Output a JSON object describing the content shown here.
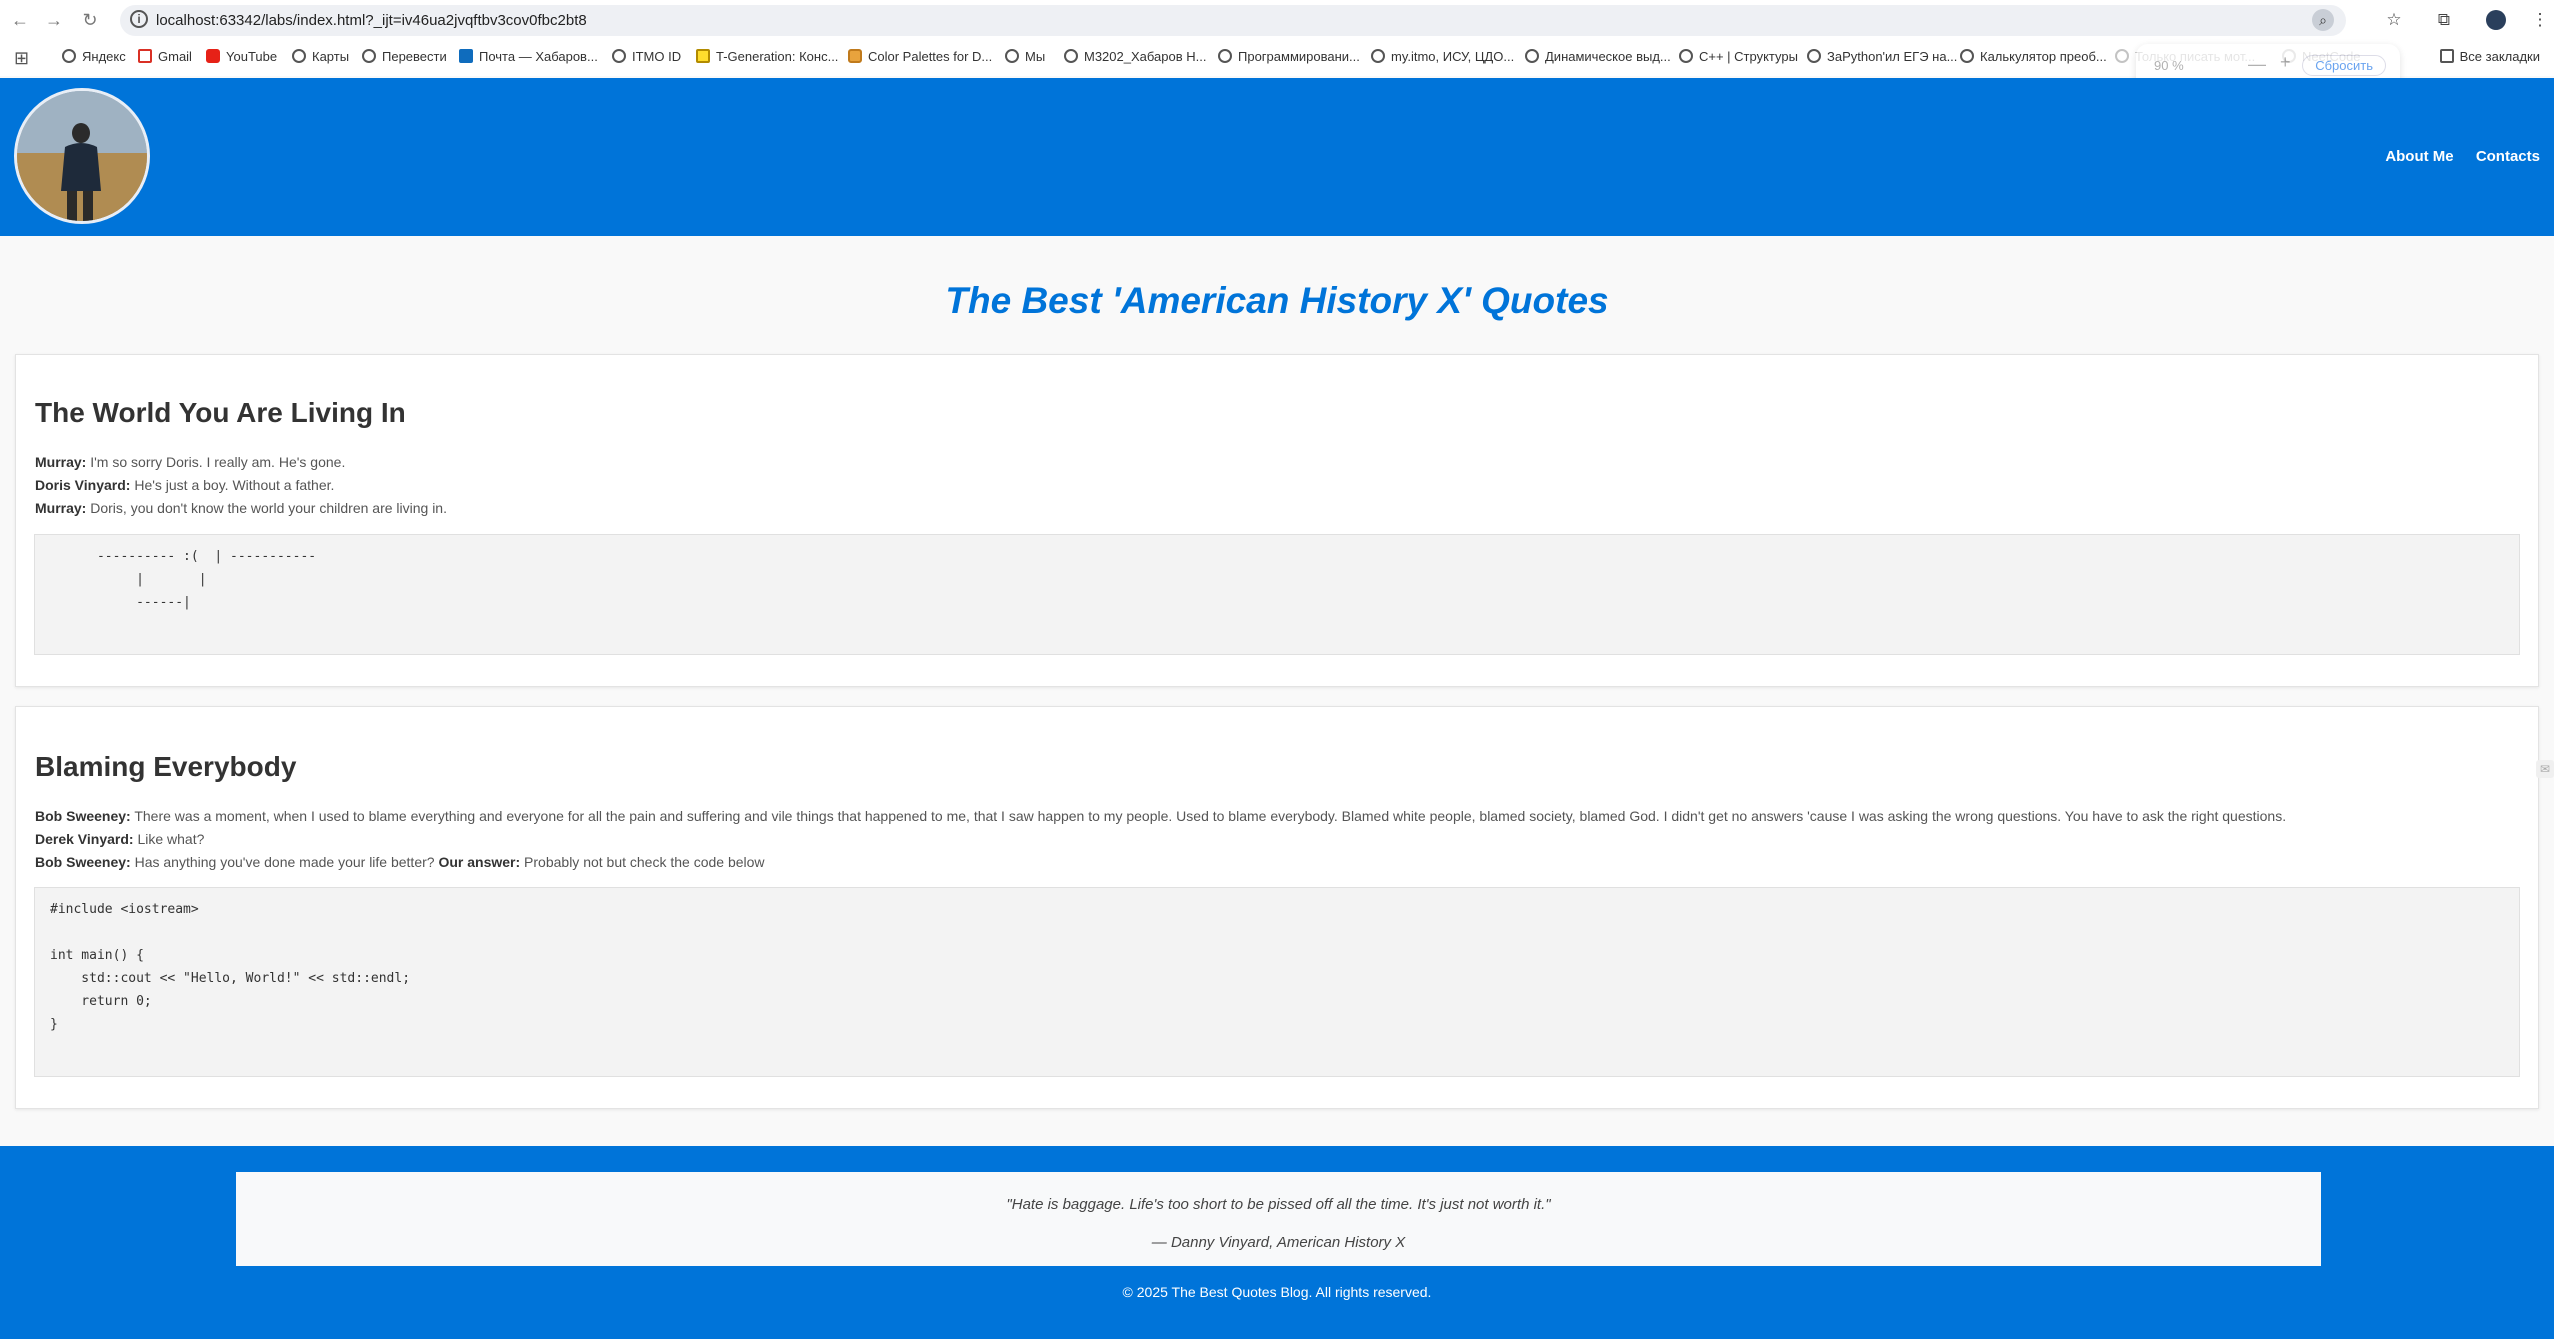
{
  "browser": {
    "url": "localhost:63342/labs/index.html?_ijt=iv46ua2jvqftbv3cov0fbc2bt8",
    "bookmarks": [
      {
        "label": "Яндекс",
        "icon": "globe-icon"
      },
      {
        "label": "Gmail",
        "icon": "gmail-icon"
      },
      {
        "label": "YouTube",
        "icon": "youtube-icon"
      },
      {
        "label": "Карты",
        "icon": "globe-icon"
      },
      {
        "label": "Перевести",
        "icon": "globe-icon"
      },
      {
        "label": "Почта — Хабаров...",
        "icon": "outlook-icon"
      },
      {
        "label": "ITMO ID",
        "icon": "globe-icon"
      },
      {
        "label": "T-Generation: Конс...",
        "icon": "tgen-icon"
      },
      {
        "label": "Color Palettes for D...",
        "icon": "palette-icon"
      },
      {
        "label": "Мы",
        "icon": "globe-icon"
      },
      {
        "label": "M3202_Хабаров Н...",
        "icon": "globe-icon"
      },
      {
        "label": "Программировани...",
        "icon": "globe-icon"
      },
      {
        "label": "my.itmo, ИСУ, ЦДО...",
        "icon": "globe-icon"
      },
      {
        "label": "Динамическое выд...",
        "icon": "globe-icon"
      },
      {
        "label": "C++ | Структуры",
        "icon": "globe-icon"
      },
      {
        "label": "ЗаPython'ил ЕГЭ на...",
        "icon": "globe-icon"
      },
      {
        "label": "Калькулятор преоб...",
        "icon": "globe-icon"
      },
      {
        "label": "Только писать мот...",
        "icon": "globe-icon"
      },
      {
        "label": "NeetCode",
        "icon": "globe-icon"
      }
    ],
    "all_bookmarks_label": "Все закладки",
    "zoom_popup": {
      "zoom": "90 %",
      "reset_label": "Сбросить",
      "minus": "—",
      "plus": "+"
    }
  },
  "site": {
    "nav": {
      "about": "About Me",
      "contacts": "Contacts"
    },
    "title": "The Best 'American History X' Quotes",
    "sections": [
      {
        "heading": "The World You Are Living In",
        "lines": [
          {
            "speaker": "Murray:",
            "text": " I'm so sorry Doris. I really am. He's gone."
          },
          {
            "speaker": "Doris Vinyard:",
            "text": " He's just a boy. Without a father."
          },
          {
            "speaker": "Murray:",
            "text": " Doris, you don't know the world your children are living in."
          }
        ],
        "code": "      ---------- :(  | -----------\n           |       |\n           ------|"
      },
      {
        "heading": "Blaming Everybody",
        "lines": [
          {
            "speaker": "Bob Sweeney:",
            "text": " There was a moment, when I used to blame everything and everyone for all the pain and suffering and vile things that happened to me, that I saw happen to my people. Used to blame everybody. Blamed white people, blamed society, blamed God. I didn't get no answers 'cause I was asking the wrong questions. You have to ask the right questions."
          },
          {
            "speaker": "Derek Vinyard:",
            "text": " Like what?"
          },
          {
            "speaker": "Bob Sweeney:",
            "text": " Has anything you've done made your life better? ",
            "extra_bold": "Our answer:",
            "extra_text": " Probably not but check the code below"
          }
        ],
        "code": "#include <iostream>\n\nint main() {\n    std::cout << \"Hello, World!\" << std::endl;\n    return 0;\n}"
      }
    ],
    "footer": {
      "quote": "\"Hate is baggage. Life's too short to be pissed off all the time. It's just not worth it.\"",
      "author": "— Danny Vinyard, American History X",
      "copyright": "© 2025 The Best Quotes Blog. All rights reserved."
    }
  },
  "colors": {
    "primary": "#0074d9",
    "page_bg": "#f9f9f9",
    "code_bg": "#f3f3f3"
  }
}
